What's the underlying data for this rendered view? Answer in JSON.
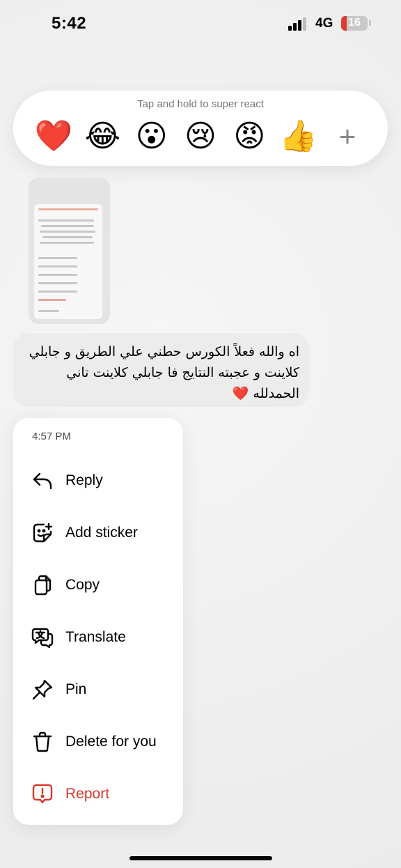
{
  "status_bar": {
    "time": "5:42",
    "network": "4G",
    "battery": "16",
    "battery_level_percent": 16
  },
  "reaction_bar": {
    "hint": "Tap and hold to super react",
    "reactions": [
      {
        "emoji": "❤️",
        "name": "heart"
      },
      {
        "emoji": "😂",
        "name": "laughing"
      },
      {
        "emoji": "😮",
        "name": "surprised"
      },
      {
        "emoji": "😢",
        "name": "crying"
      },
      {
        "emoji": "😡",
        "name": "angry"
      },
      {
        "emoji": "👍",
        "name": "thumbs-up"
      }
    ],
    "more_icon": "plus-icon",
    "more_glyph": "+"
  },
  "message": {
    "text": "اه والله فعلاً الكورس حطني علي الطريق و جابلي كلاينت و عجبته النتايج فا جابلي كلاينت تاني الحمدلله ❤️"
  },
  "context_menu": {
    "timestamp": "4:57 PM",
    "items": [
      {
        "label": "Reply",
        "icon": "reply-icon",
        "danger": false
      },
      {
        "label": "Add sticker",
        "icon": "sticker-icon",
        "danger": false
      },
      {
        "label": "Copy",
        "icon": "copy-icon",
        "danger": false
      },
      {
        "label": "Translate",
        "icon": "translate-icon",
        "danger": false
      },
      {
        "label": "Pin",
        "icon": "pin-icon",
        "danger": false
      },
      {
        "label": "Delete for you",
        "icon": "trash-icon",
        "danger": true
      },
      {
        "label": "Report",
        "icon": "report-icon",
        "danger": true
      }
    ]
  },
  "colors": {
    "danger": "#d8392b",
    "battery_low": "#e03b2f",
    "background": "#efefef",
    "menu_background": "#ffffff"
  }
}
